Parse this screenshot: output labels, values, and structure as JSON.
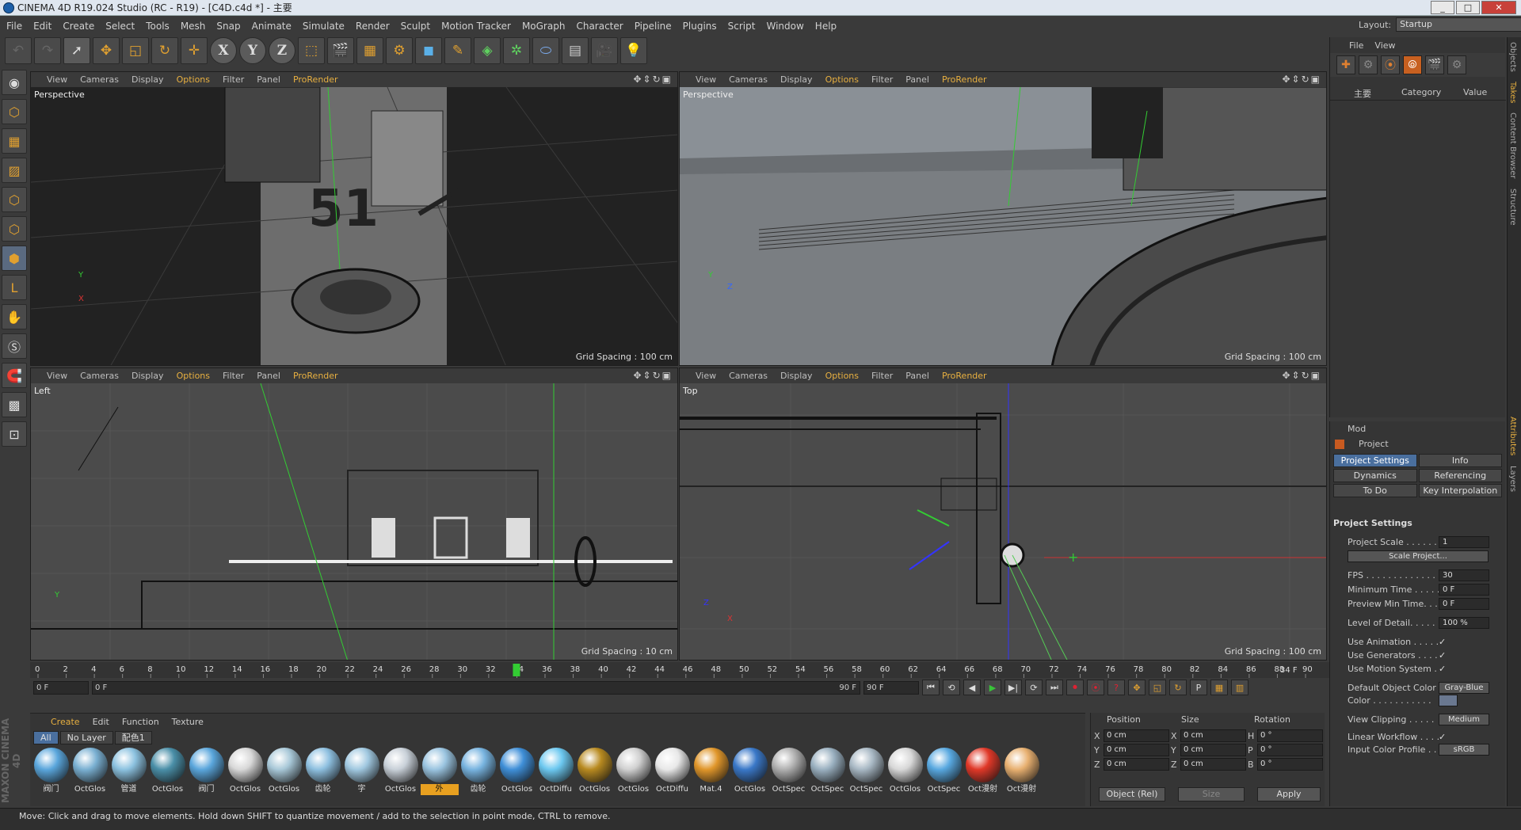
{
  "window": {
    "title": "CINEMA 4D R19.024 Studio (RC - R19) - [C4D.c4d *] - 主要",
    "controls": [
      "_",
      "□",
      "✕"
    ]
  },
  "menubar": [
    "File",
    "Edit",
    "Create",
    "Select",
    "Tools",
    "Mesh",
    "Snap",
    "Animate",
    "Simulate",
    "Render",
    "Sculpt",
    "Motion Tracker",
    "MoGraph",
    "Character",
    "Pipeline",
    "Plugins",
    "Script",
    "Window",
    "Help"
  ],
  "layout": {
    "label": "Layout:",
    "value": "Startup"
  },
  "viewport_menu": [
    "View",
    "Cameras",
    "Display",
    "Options",
    "Filter",
    "Panel",
    "ProRender"
  ],
  "viewports": [
    {
      "name": "Perspective",
      "grid": "Grid Spacing : 100 cm"
    },
    {
      "name": "Perspective",
      "grid": "Grid Spacing : 100 cm"
    },
    {
      "name": "Left",
      "grid": "Grid Spacing : 10 cm"
    },
    {
      "name": "Top",
      "grid": "Grid Spacing : 100 cm"
    }
  ],
  "timeline": {
    "ticks": [
      "0",
      "2",
      "4",
      "6",
      "8",
      "10",
      "12",
      "14",
      "16",
      "18",
      "20",
      "22",
      "24",
      "26",
      "28",
      "30",
      "32",
      "34",
      "36",
      "38",
      "40",
      "42",
      "44",
      "46",
      "48",
      "50",
      "52",
      "54",
      "56",
      "58",
      "60",
      "62",
      "64",
      "66",
      "68",
      "70",
      "72",
      "74",
      "76",
      "78",
      "80",
      "82",
      "84",
      "86",
      "88",
      "90"
    ],
    "current_frame": 34,
    "current_label": "34 F",
    "start": "0 F",
    "range_start": "0 F",
    "range_end": "90 F",
    "end": "90 F"
  },
  "material_panel": {
    "tabs": [
      "Create",
      "Edit",
      "Function",
      "Texture"
    ],
    "filters": [
      "All",
      "No Layer",
      "配色1"
    ],
    "materials": [
      {
        "name": "阀门",
        "color": "#5aa6dc"
      },
      {
        "name": "OctGlos",
        "color": "#7ab0d2"
      },
      {
        "name": "管道",
        "color": "#8cc2e0"
      },
      {
        "name": "OctGlos",
        "color": "#4a8fa8"
      },
      {
        "name": "阀门",
        "color": "#5aa6dc"
      },
      {
        "name": "OctGlos",
        "color": "#d8d8d8"
      },
      {
        "name": "OctGlos",
        "color": "#a8c8d8"
      },
      {
        "name": "齿轮",
        "color": "#8ec0e0"
      },
      {
        "name": "字",
        "color": "#a0c8e0"
      },
      {
        "name": "OctGlos",
        "color": "#c8d0d8"
      },
      {
        "name": "外",
        "color": "#9ac4e0"
      },
      {
        "name": "齿轮",
        "color": "#78b4e0"
      },
      {
        "name": "OctGlos",
        "color": "#3f8fd8"
      },
      {
        "name": "OctDiffu",
        "color": "#6cc8f0"
      },
      {
        "name": "OctGlos",
        "color": "#b88a20"
      },
      {
        "name": "OctGlos",
        "color": "#d0d0d0"
      },
      {
        "name": "OctDiffu",
        "color": "#e8e8e8"
      },
      {
        "name": "Mat.4",
        "color": "#e0962a"
      },
      {
        "name": "OctGlos",
        "color": "#3a78c8"
      },
      {
        "name": "OctSpec",
        "color": "#b0b0b0"
      },
      {
        "name": "OctSpec",
        "color": "#9ab0c0"
      },
      {
        "name": "OctSpec",
        "color": "#a8b8c4"
      },
      {
        "name": "OctGlos",
        "color": "#d8d8d8"
      },
      {
        "name": "OctSpec",
        "color": "#58a8e0"
      },
      {
        "name": "Oct漫射",
        "color": "#e03828"
      },
      {
        "name": "Oct漫射",
        "color": "#e8b070"
      }
    ],
    "highlighted_index": 10
  },
  "coordinates": {
    "headers": [
      "Position",
      "Size",
      "Rotation"
    ],
    "rows": [
      {
        "pl": "X",
        "p": "0 cm",
        "sl": "X",
        "s": "0 cm",
        "rl": "H",
        "r": "0 °"
      },
      {
        "pl": "Y",
        "p": "0 cm",
        "sl": "Y",
        "s": "0 cm",
        "rl": "P",
        "r": "0 °"
      },
      {
        "pl": "Z",
        "p": "0 cm",
        "sl": "Z",
        "s": "0 cm",
        "rl": "B",
        "r": "0 °"
      }
    ],
    "mode": "Object (Rel)",
    "size_mode": "Size",
    "apply": "Apply"
  },
  "object_manager": {
    "menu": [
      "File",
      "View"
    ],
    "columns": [
      "主要",
      "Category",
      "Value"
    ]
  },
  "attributes": {
    "menu": "Mod",
    "title": "Project",
    "tabs": [
      "Project Settings",
      "Info",
      "Dynamics",
      "Referencing",
      "To Do",
      "Key Interpolation"
    ],
    "section": "Project Settings",
    "rows": [
      {
        "label": "Project Scale . . . . . .",
        "value": "1"
      },
      {
        "label": "",
        "value": "Scale Project..."
      },
      {
        "label": "FPS . . . . . . . . . . . . .",
        "value": "30"
      },
      {
        "label": "Minimum Time . . . . .",
        "value": "0 F"
      },
      {
        "label": "Preview Min Time. . .",
        "value": "0 F"
      },
      {
        "label": "Level of Detail. . . . .",
        "value": "100 %"
      },
      {
        "label": "Use Animation . . . . .",
        "value": "✓"
      },
      {
        "label": "Use Generators . . . .",
        "value": "✓"
      },
      {
        "label": "Use Motion System . .",
        "value": "✓"
      },
      {
        "label": "Default Object Color",
        "value": "Gray-Blue"
      },
      {
        "label": "Color . . . . . . . . . . .",
        "value": ""
      },
      {
        "label": "View Clipping . . . . .",
        "value": "Medium"
      },
      {
        "label": "Linear Workflow . . . .",
        "value": "✓"
      },
      {
        "label": "Input Color Profile . .",
        "value": "sRGB"
      }
    ]
  },
  "side_tabs": [
    "Objects",
    "Takes",
    "Content Browser",
    "Structure",
    "Attributes",
    "Layers"
  ],
  "status": "Move: Click and drag to move elements. Hold down SHIFT to quantize movement / add to the selection in point mode, CTRL to remove."
}
